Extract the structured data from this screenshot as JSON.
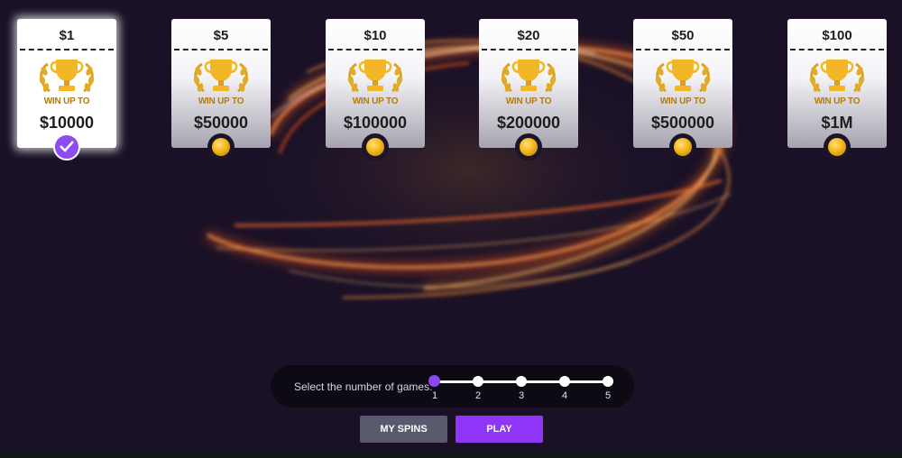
{
  "cards": [
    {
      "price": "$1",
      "win_label": "WIN UP TO",
      "prize": "$10000",
      "selected": true
    },
    {
      "price": "$5",
      "win_label": "WIN UP TO",
      "prize": "$50000",
      "selected": false
    },
    {
      "price": "$10",
      "win_label": "WIN UP TO",
      "prize": "$100000",
      "selected": false
    },
    {
      "price": "$20",
      "win_label": "WIN UP TO",
      "prize": "$200000",
      "selected": false
    },
    {
      "price": "$50",
      "win_label": "WIN UP TO",
      "prize": "$500000",
      "selected": false
    },
    {
      "price": "$100",
      "win_label": "WIN UP TO",
      "prize": "$1M",
      "selected": false
    }
  ],
  "games_selector": {
    "label": "Select the number of games:",
    "options": [
      "1",
      "2",
      "3",
      "4",
      "5"
    ],
    "selected": "1"
  },
  "buttons": {
    "my_spins": "MY SPINS",
    "play": "PLAY"
  },
  "colors": {
    "background": "#1a1127",
    "accent": "#8e35f7",
    "secondary_button": "#5a5a6e",
    "gold": "#f4b71c"
  },
  "icons": {
    "card_emblem": "trophy-laurel-icon",
    "selected_badge": "checkmark-icon",
    "unselected_badge": "gold-coin-icon"
  }
}
